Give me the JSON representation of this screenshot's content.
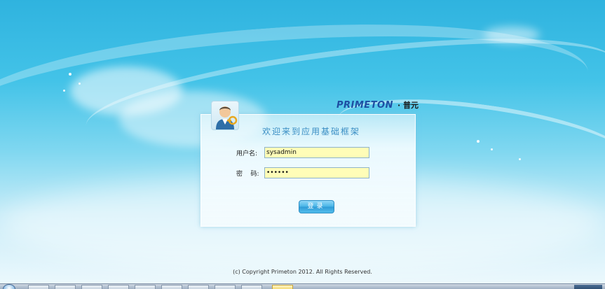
{
  "brand": {
    "logo_text": "PRIMETON",
    "logo_cn": "· 普元"
  },
  "login": {
    "welcome": "欢迎来到应用基础框架",
    "username_label": "用户名:",
    "username_value": "sysadmin",
    "password_label": "密    码:",
    "password_value": "••••••",
    "submit_label": "登录"
  },
  "footer": {
    "copyright": "(c) Copyright Primeton 2012. All Rights Reserved."
  },
  "colors": {
    "sky_top": "#2fb3df",
    "sky_bottom": "#eef9fd",
    "accent": "#3a8ec4",
    "input_bg": "#fffdb8",
    "button": "#45b3e6",
    "logo": "#1e4fa3"
  },
  "icons": {
    "avatar": "user-key-icon"
  }
}
